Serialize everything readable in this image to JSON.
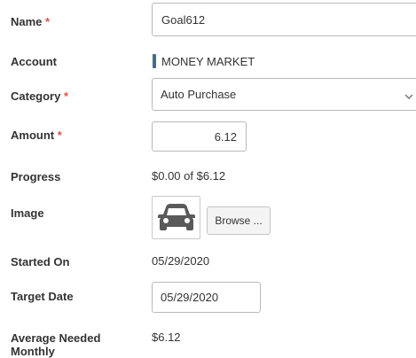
{
  "fields": {
    "name": {
      "label": "Name",
      "required_mark": "*",
      "value": "Goal612"
    },
    "account": {
      "label": "Account",
      "value": "MONEY MARKET",
      "bar_color": "#4a6a8a"
    },
    "category": {
      "label": "Category",
      "required_mark": "*",
      "value": "Auto Purchase"
    },
    "amount": {
      "label": "Amount",
      "required_mark": "*",
      "value": "6.12"
    },
    "progress": {
      "label": "Progress",
      "value": "$0.00 of $6.12"
    },
    "image": {
      "label": "Image",
      "icon": "car-icon",
      "browse_label": "Browse ..."
    },
    "started_on": {
      "label": "Started On",
      "value": "05/29/2020"
    },
    "target_date": {
      "label": "Target Date",
      "value": "05/29/2020"
    },
    "average_needed": {
      "label_line1": "Average Needed",
      "label_line2": "Monthly",
      "value": "$6.12"
    }
  },
  "colors": {
    "required": "#d9534f",
    "label": "#333333",
    "border": "#b9b9b9"
  }
}
